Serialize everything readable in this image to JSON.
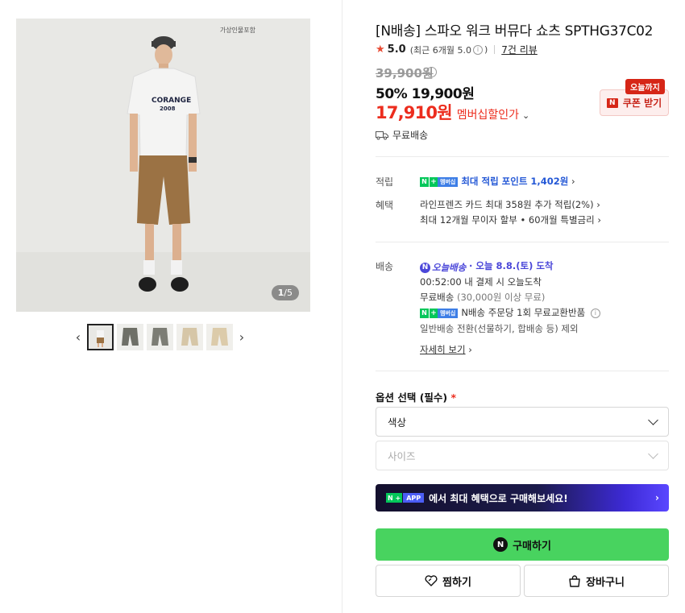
{
  "gallery": {
    "watermark": "가상인물포함",
    "counter_current": "1",
    "counter_total": "/5",
    "prev_arrow": "‹",
    "next_arrow": "›",
    "thumbnail_count": 5
  },
  "product": {
    "title": "[N배송] 스파오 워크 버뮤다 쇼츠 SPTHG37C02",
    "rating": "5.0",
    "rating_sub": "(최근 6개월 5.0",
    "rating_sub_end": ")",
    "reviews": "7건 리뷰",
    "original_price": "39,900원",
    "sale_price": "50% 19,900원",
    "member_price": "17,910원",
    "member_label": "멤버십할인가",
    "coupon_tag": "오늘까지",
    "coupon_button": "쿠폰 받기",
    "free_shipping": "무료배송"
  },
  "benefits": {
    "points_label": "적립",
    "points_badge_m": "멤버십",
    "points_text": "최대 적립 포인트 1,402원",
    "perks_label": "혜택",
    "perk1": "라인프렌즈 카드 최대 358원 추가 적립(2%)",
    "perk2": "최대 12개월 무이자 할부 • 60개월 특별금리"
  },
  "delivery": {
    "label": "배송",
    "logo_text": "오늘배송",
    "arrival": "· 오늘 8.8.(토) 도착",
    "cutoff": "00:52:00 내 결제 시 오늘도착",
    "free_ship": "무료배송",
    "free_ship_cond": "(30,000원 이상 무료)",
    "n_badge_m": "멤버십",
    "exchange": "N배송 주문당 1회 무료교환반품",
    "normal": "일반배송 전환(선물하기, 합배송 등) 제외",
    "detail_link": "자세히 보기"
  },
  "options": {
    "title": "옵션 선택 (필수)",
    "required_mark": "*",
    "color_select": "색상",
    "size_select": "사이즈"
  },
  "app_banner": {
    "chip_n": "N +",
    "chip_app": "APP",
    "text": "에서 최대 혜택으로 구매해보세요!"
  },
  "actions": {
    "buy": "구매하기",
    "wishlist": "찜하기",
    "cart": "장바구니"
  },
  "colors": {
    "accent_red": "#ec2d1e",
    "buy_green": "#48d35f",
    "naver_green": "#03c75a",
    "delivery_purple": "#4b47d9"
  }
}
